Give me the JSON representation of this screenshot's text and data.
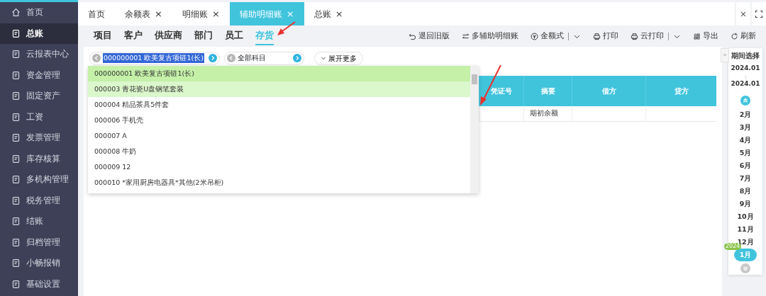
{
  "sidebar": {
    "items": [
      {
        "label": "首页",
        "selected": false
      },
      {
        "label": "总账",
        "selected": true
      },
      {
        "label": "云报表中心",
        "selected": false
      },
      {
        "label": "资金管理",
        "selected": false
      },
      {
        "label": "固定资产",
        "selected": false
      },
      {
        "label": "工资",
        "selected": false
      },
      {
        "label": "发票管理",
        "selected": false
      },
      {
        "label": "库存核算",
        "selected": false
      },
      {
        "label": "多机构管理",
        "selected": false
      },
      {
        "label": "税务管理",
        "selected": false
      },
      {
        "label": "结账",
        "selected": false
      },
      {
        "label": "归档管理",
        "selected": false
      },
      {
        "label": "小畅报销",
        "selected": false
      },
      {
        "label": "基础设置",
        "selected": false
      }
    ]
  },
  "tabs": [
    {
      "label": "首页",
      "closable": false,
      "selected": false
    },
    {
      "label": "余额表",
      "closable": true,
      "selected": false
    },
    {
      "label": "明细账",
      "closable": true,
      "selected": false
    },
    {
      "label": "辅助明细账",
      "closable": true,
      "selected": true
    },
    {
      "label": "总账",
      "closable": true,
      "selected": false
    }
  ],
  "close_mark": "×",
  "collapse_mark": "»",
  "subtabs": [
    {
      "label": "项目",
      "selected": false
    },
    {
      "label": "客户",
      "selected": false
    },
    {
      "label": "供应商",
      "selected": false
    },
    {
      "label": "部门",
      "selected": false
    },
    {
      "label": "员工",
      "selected": false
    },
    {
      "label": "存货",
      "selected": true
    }
  ],
  "toolbar": [
    {
      "kind": "undo",
      "label": "退回旧版",
      "dropdown": false
    },
    {
      "kind": "swap",
      "label": "多辅助明细账",
      "dropdown": false
    },
    {
      "kind": "money",
      "label": "金额式",
      "dropdown": true
    },
    {
      "kind": "print",
      "label": "打印",
      "dropdown": false
    },
    {
      "kind": "print",
      "label": "云打印",
      "dropdown": true
    },
    {
      "kind": "export",
      "label": "导出",
      "dropdown": false
    },
    {
      "kind": "refresh",
      "label": "刷新",
      "dropdown": false
    }
  ],
  "filters": {
    "item_combo": {
      "value": "000000001 欧美复古项链1(长)",
      "text_selected": true
    },
    "subject_combo": {
      "value": "全部科目"
    },
    "expand_button": "展开更多"
  },
  "dropdown": {
    "options": [
      {
        "label": "000000001 欧美复古项链1(长)",
        "selected": true,
        "hovered": false
      },
      {
        "label": "000003 青花瓷U盘钢笔套装",
        "selected": false,
        "hovered": true
      },
      {
        "label": "000004 精品茶具5件套",
        "selected": false,
        "hovered": false
      },
      {
        "label": "000006 手机壳",
        "selected": false,
        "hovered": false
      },
      {
        "label": "000007 A",
        "selected": false,
        "hovered": false
      },
      {
        "label": "000008 牛奶",
        "selected": false,
        "hovered": false
      },
      {
        "label": "000009 12",
        "selected": false,
        "hovered": false
      },
      {
        "label": "000010 *家用厨房电器具*其他(2米吊柜)",
        "selected": false,
        "hovered": false
      }
    ]
  },
  "table": {
    "columns": [
      "凭证号",
      "摘要",
      "借方",
      "贷方"
    ],
    "rows": [
      {
        "summary": "期初余额"
      }
    ]
  },
  "period": {
    "title": "期间选择",
    "from": "2024.01",
    "to": "2024.01",
    "months": [
      {
        "label": "2月",
        "selected": false
      },
      {
        "label": "3月",
        "selected": false
      },
      {
        "label": "4月",
        "selected": false
      },
      {
        "label": "5月",
        "selected": false
      },
      {
        "label": "6月",
        "selected": false
      },
      {
        "label": "7月",
        "selected": false
      },
      {
        "label": "8月",
        "selected": false
      },
      {
        "label": "9月",
        "selected": false
      },
      {
        "label": "10月",
        "selected": false
      },
      {
        "label": "11月",
        "selected": false
      },
      {
        "label": "12月",
        "selected": false
      },
      {
        "label": "1月",
        "selected": true,
        "year": "2024"
      }
    ]
  }
}
